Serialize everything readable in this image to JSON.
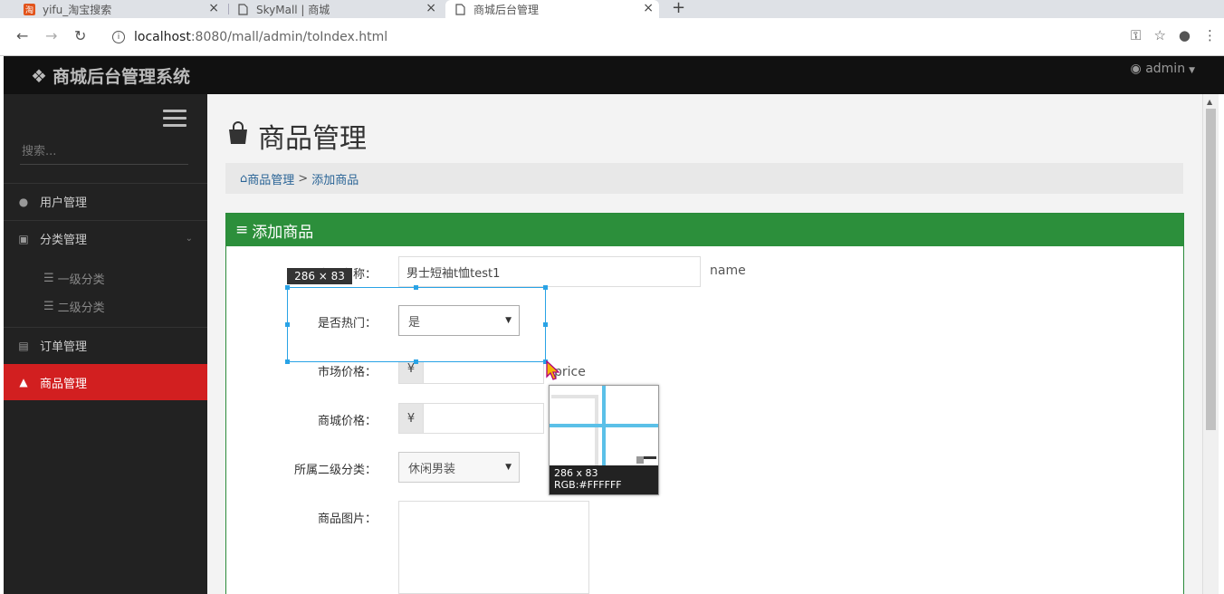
{
  "browser": {
    "tabs": [
      {
        "title": "yifu_淘宝搜索",
        "favicon": "taobao-icon"
      },
      {
        "title": "SkyMall | 商城",
        "favicon": "page-icon"
      },
      {
        "title": "商城后台管理",
        "favicon": "page-icon",
        "active": true
      }
    ],
    "url_host": "localhost",
    "url_path": ":8080/mall/admin/toIndex.html"
  },
  "header": {
    "brand": "商城后台管理系统",
    "user": "admin"
  },
  "sidebar": {
    "search_placeholder": "搜索...",
    "items": [
      {
        "label": "用户管理",
        "icon": "user-circle-icon"
      },
      {
        "label": "分类管理",
        "icon": "category-icon"
      },
      {
        "label": "订单管理",
        "icon": "file-icon"
      },
      {
        "label": "商品管理",
        "icon": "shopping-bag-icon"
      }
    ],
    "subitems": [
      {
        "label": "一级分类",
        "icon": "list-icon"
      },
      {
        "label": "二级分类",
        "icon": "list-icon"
      }
    ]
  },
  "main": {
    "title": "商品管理",
    "breadcrumb": {
      "home": "商品管理",
      "sep": ">",
      "current": "添加商品"
    },
    "panel_title": "添加商品",
    "form": {
      "name_label": "商品名称：",
      "name_value": "男士短袖t恤test1",
      "name_hint": "name",
      "hot_label": "是否热门：",
      "hot_value": "是",
      "market_price_label": "市场价格：",
      "price_hint": "price",
      "shop_price_label": "商城价格：",
      "currency": "¥",
      "category_label": "所属二级分类：",
      "category_value": "休闲男装",
      "image_label": "商品图片："
    }
  },
  "overlay": {
    "size_label": "286 × 83",
    "mag_size": "286 x 83",
    "mag_rgb": "RGB:#FFFFFF"
  }
}
